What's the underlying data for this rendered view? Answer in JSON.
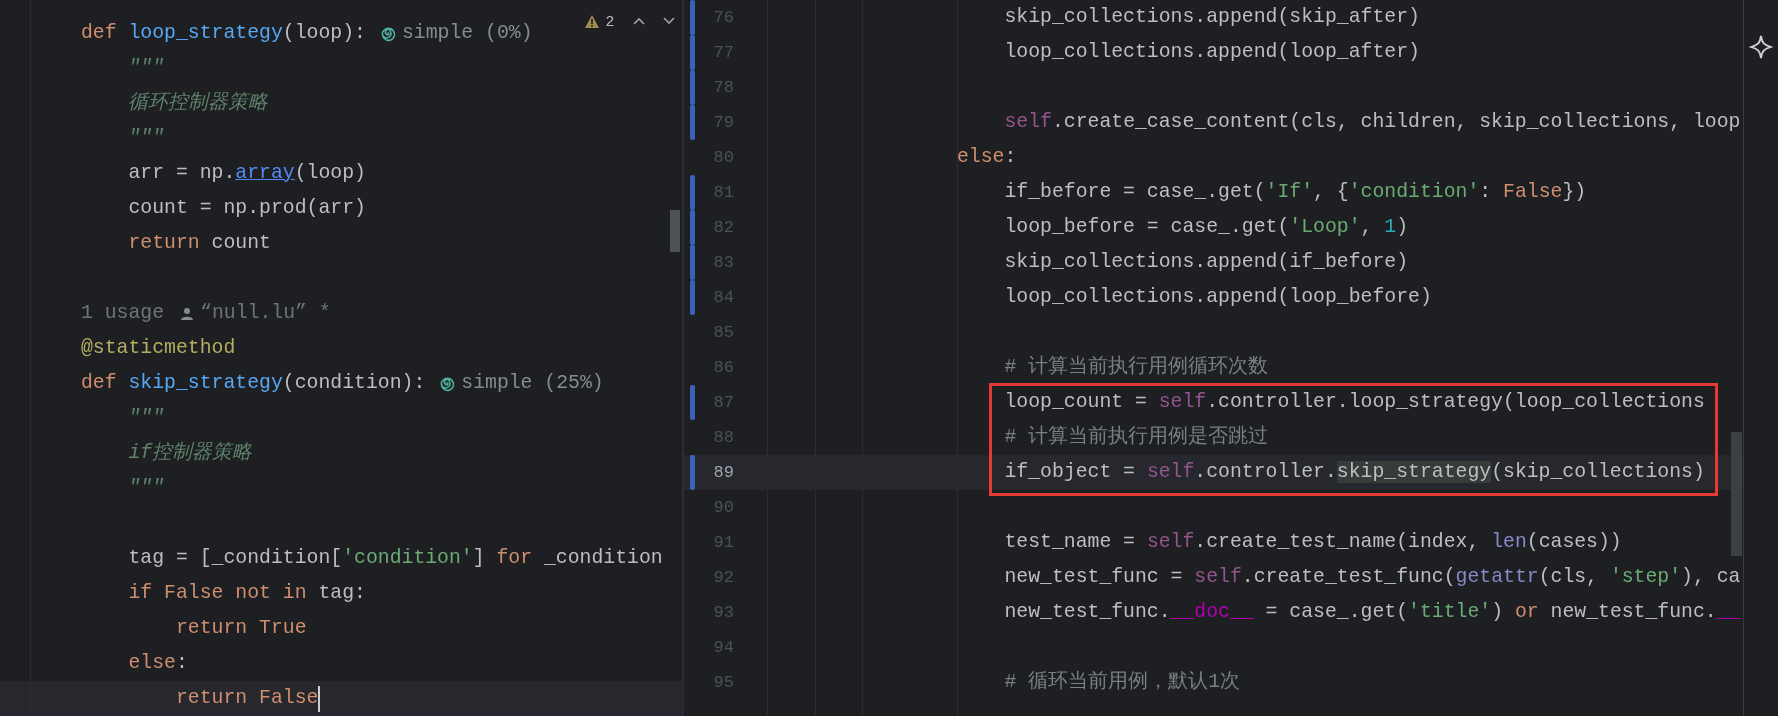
{
  "left_pane": {
    "problems": {
      "count": "2"
    },
    "lines": [
      {
        "kind": "code",
        "tokens": [
          {
            "kind": "kw",
            "text": "def "
          },
          {
            "kind": "fn",
            "text": "loop_strategy"
          },
          {
            "kind": "plain",
            "text": "(loop):"
          }
        ],
        "hint": "simple (0%)"
      },
      {
        "kind": "code",
        "tokens": [
          {
            "kind": "doc",
            "text": "    \"\"\""
          }
        ]
      },
      {
        "kind": "code",
        "tokens": [
          {
            "kind": "doc",
            "text": "    循环控制器策略"
          }
        ]
      },
      {
        "kind": "code",
        "tokens": [
          {
            "kind": "doc",
            "text": "    \"\"\""
          }
        ]
      },
      {
        "kind": "code",
        "tokens": [
          {
            "kind": "plain",
            "text": "    arr = np."
          },
          {
            "kind": "link",
            "text": "array"
          },
          {
            "kind": "plain",
            "text": "(loop)"
          }
        ]
      },
      {
        "kind": "code",
        "tokens": [
          {
            "kind": "plain",
            "text": "    count = np.prod(arr)"
          }
        ]
      },
      {
        "kind": "code",
        "tokens": [
          {
            "kind": "kw",
            "text": "    return "
          },
          {
            "kind": "plain",
            "text": "count"
          }
        ]
      },
      {
        "kind": "code"
      },
      {
        "kind": "usage",
        "usages": "1 usage",
        "author": "“null.lu” *"
      },
      {
        "kind": "code",
        "tokens": [
          {
            "kind": "decorator",
            "text": "@staticmethod"
          }
        ]
      },
      {
        "kind": "code",
        "tokens": [
          {
            "kind": "kw",
            "text": "def "
          },
          {
            "kind": "fn",
            "text": "skip_strategy"
          },
          {
            "kind": "plain",
            "text": "(condition):"
          }
        ],
        "hint": "simple (25%)"
      },
      {
        "kind": "code",
        "tokens": [
          {
            "kind": "doc",
            "text": "    \"\"\""
          }
        ]
      },
      {
        "kind": "code",
        "tokens": [
          {
            "kind": "doc",
            "text": "    if控制器策略"
          }
        ]
      },
      {
        "kind": "code",
        "tokens": [
          {
            "kind": "doc",
            "text": "    \"\"\""
          }
        ]
      },
      {
        "kind": "code"
      },
      {
        "kind": "code",
        "tokens": [
          {
            "kind": "plain",
            "text": "    tag = [_condition["
          },
          {
            "kind": "str",
            "text": "'condition'"
          },
          {
            "kind": "plain",
            "text": "] "
          },
          {
            "kind": "kw",
            "text": "for "
          },
          {
            "kind": "plain",
            "text": "_condition"
          }
        ]
      },
      {
        "kind": "code",
        "tokens": [
          {
            "kind": "kw",
            "text": "    if False not in "
          },
          {
            "kind": "plain",
            "text": "tag:"
          }
        ]
      },
      {
        "kind": "code",
        "tokens": [
          {
            "kind": "kw",
            "text": "        return True"
          }
        ]
      },
      {
        "kind": "code",
        "tokens": [
          {
            "kind": "kw",
            "text": "    else"
          },
          {
            "kind": "plain",
            "text": ":"
          }
        ]
      },
      {
        "kind": "code",
        "tokens": [
          {
            "kind": "kw",
            "text": "        return False"
          }
        ],
        "current": true,
        "caret": true
      }
    ]
  },
  "right_pane": {
    "lines": [
      {
        "number": "76",
        "changed": true,
        "tokens": [
          {
            "kind": "plain",
            "text": "                    skip_collections.append(skip_after)"
          }
        ]
      },
      {
        "number": "77",
        "changed": true,
        "tokens": [
          {
            "kind": "plain",
            "text": "                    loop_collections.append(loop_after)"
          }
        ]
      },
      {
        "number": "78",
        "changed": true
      },
      {
        "number": "79",
        "changed": true,
        "tokens": [
          {
            "kind": "self",
            "text": "                    self"
          },
          {
            "kind": "plain",
            "text": ".create_case_content(cls, children, skip_collections, loop"
          }
        ]
      },
      {
        "number": "80",
        "changed": false,
        "tokens": [
          {
            "kind": "kw",
            "text": "                else"
          },
          {
            "kind": "plain",
            "text": ":"
          }
        ]
      },
      {
        "number": "81",
        "changed": true,
        "tokens": [
          {
            "kind": "plain",
            "text": "                    if_before = case_.get("
          },
          {
            "kind": "str",
            "text": "'If'"
          },
          {
            "kind": "plain",
            "text": ", {"
          },
          {
            "kind": "str",
            "text": "'condition'"
          },
          {
            "kind": "plain",
            "text": ": "
          },
          {
            "kind": "kw",
            "text": "False"
          },
          {
            "kind": "plain",
            "text": "})"
          }
        ]
      },
      {
        "number": "82",
        "changed": true,
        "tokens": [
          {
            "kind": "plain",
            "text": "                    loop_before = case_.get("
          },
          {
            "kind": "str",
            "text": "'Loop'"
          },
          {
            "kind": "plain",
            "text": ", "
          },
          {
            "kind": "num",
            "text": "1"
          },
          {
            "kind": "plain",
            "text": ")"
          }
        ]
      },
      {
        "number": "83",
        "changed": true,
        "tokens": [
          {
            "kind": "plain",
            "text": "                    skip_collections.append(if_before)"
          }
        ]
      },
      {
        "number": "84",
        "changed": true,
        "tokens": [
          {
            "kind": "plain",
            "text": "                    loop_collections.append(loop_before)"
          }
        ]
      },
      {
        "number": "85",
        "changed": false
      },
      {
        "number": "86",
        "changed": false,
        "tokens": [
          {
            "kind": "comment",
            "text": "                    # 计算当前执行用例循环次数"
          }
        ]
      },
      {
        "number": "87",
        "changed": true,
        "boxed": true,
        "tokens": [
          {
            "kind": "plain",
            "text": "                    loop_count = "
          },
          {
            "kind": "self",
            "text": "self"
          },
          {
            "kind": "plain",
            "text": ".controller.loop_strategy(loop_collections"
          }
        ]
      },
      {
        "number": "88",
        "changed": false,
        "boxed": true,
        "tokens": [
          {
            "kind": "comment",
            "text": "                    # 计算当前执行用例是否跳过"
          }
        ]
      },
      {
        "number": "89",
        "changed": true,
        "boxed": true,
        "current": true,
        "tokens": [
          {
            "kind": "plain",
            "text": "                    if_object = "
          },
          {
            "kind": "self",
            "text": "self"
          },
          {
            "kind": "plain",
            "text": ".controller."
          },
          {
            "kind": "plain",
            "text": "skip_strategy",
            "marked": true
          },
          {
            "kind": "plain",
            "text": "(skip_collections)"
          }
        ]
      },
      {
        "number": "90",
        "changed": false
      },
      {
        "number": "91",
        "changed": false,
        "tokens": [
          {
            "kind": "plain",
            "text": "                    test_name = "
          },
          {
            "kind": "self",
            "text": "self"
          },
          {
            "kind": "plain",
            "text": ".create_test_name(index, "
          },
          {
            "kind": "builtin",
            "text": "len"
          },
          {
            "kind": "plain",
            "text": "(cases))"
          }
        ]
      },
      {
        "number": "92",
        "changed": false,
        "tokens": [
          {
            "kind": "plain",
            "text": "                    new_test_func = "
          },
          {
            "kind": "self",
            "text": "self"
          },
          {
            "kind": "plain",
            "text": ".create_test_func("
          },
          {
            "kind": "builtin",
            "text": "getattr"
          },
          {
            "kind": "plain",
            "text": "(cls, "
          },
          {
            "kind": "str",
            "text": "'step'"
          },
          {
            "kind": "plain",
            "text": "), ca"
          }
        ]
      },
      {
        "number": "93",
        "changed": false,
        "tokens": [
          {
            "kind": "plain",
            "text": "                    new_test_func."
          },
          {
            "kind": "dunder",
            "text": "__doc__"
          },
          {
            "kind": "plain",
            "text": " = case_.get("
          },
          {
            "kind": "str",
            "text": "'title'"
          },
          {
            "kind": "plain",
            "text": ") "
          },
          {
            "kind": "kw",
            "text": "or"
          },
          {
            "kind": "plain",
            "text": " new_test_func."
          },
          {
            "kind": "dunder",
            "text": "__"
          }
        ]
      },
      {
        "number": "94",
        "changed": false
      },
      {
        "number": "95",
        "changed": false,
        "tokens": [
          {
            "kind": "comment",
            "text": "                    # 循环当前用例，默认1次"
          }
        ]
      }
    ]
  }
}
